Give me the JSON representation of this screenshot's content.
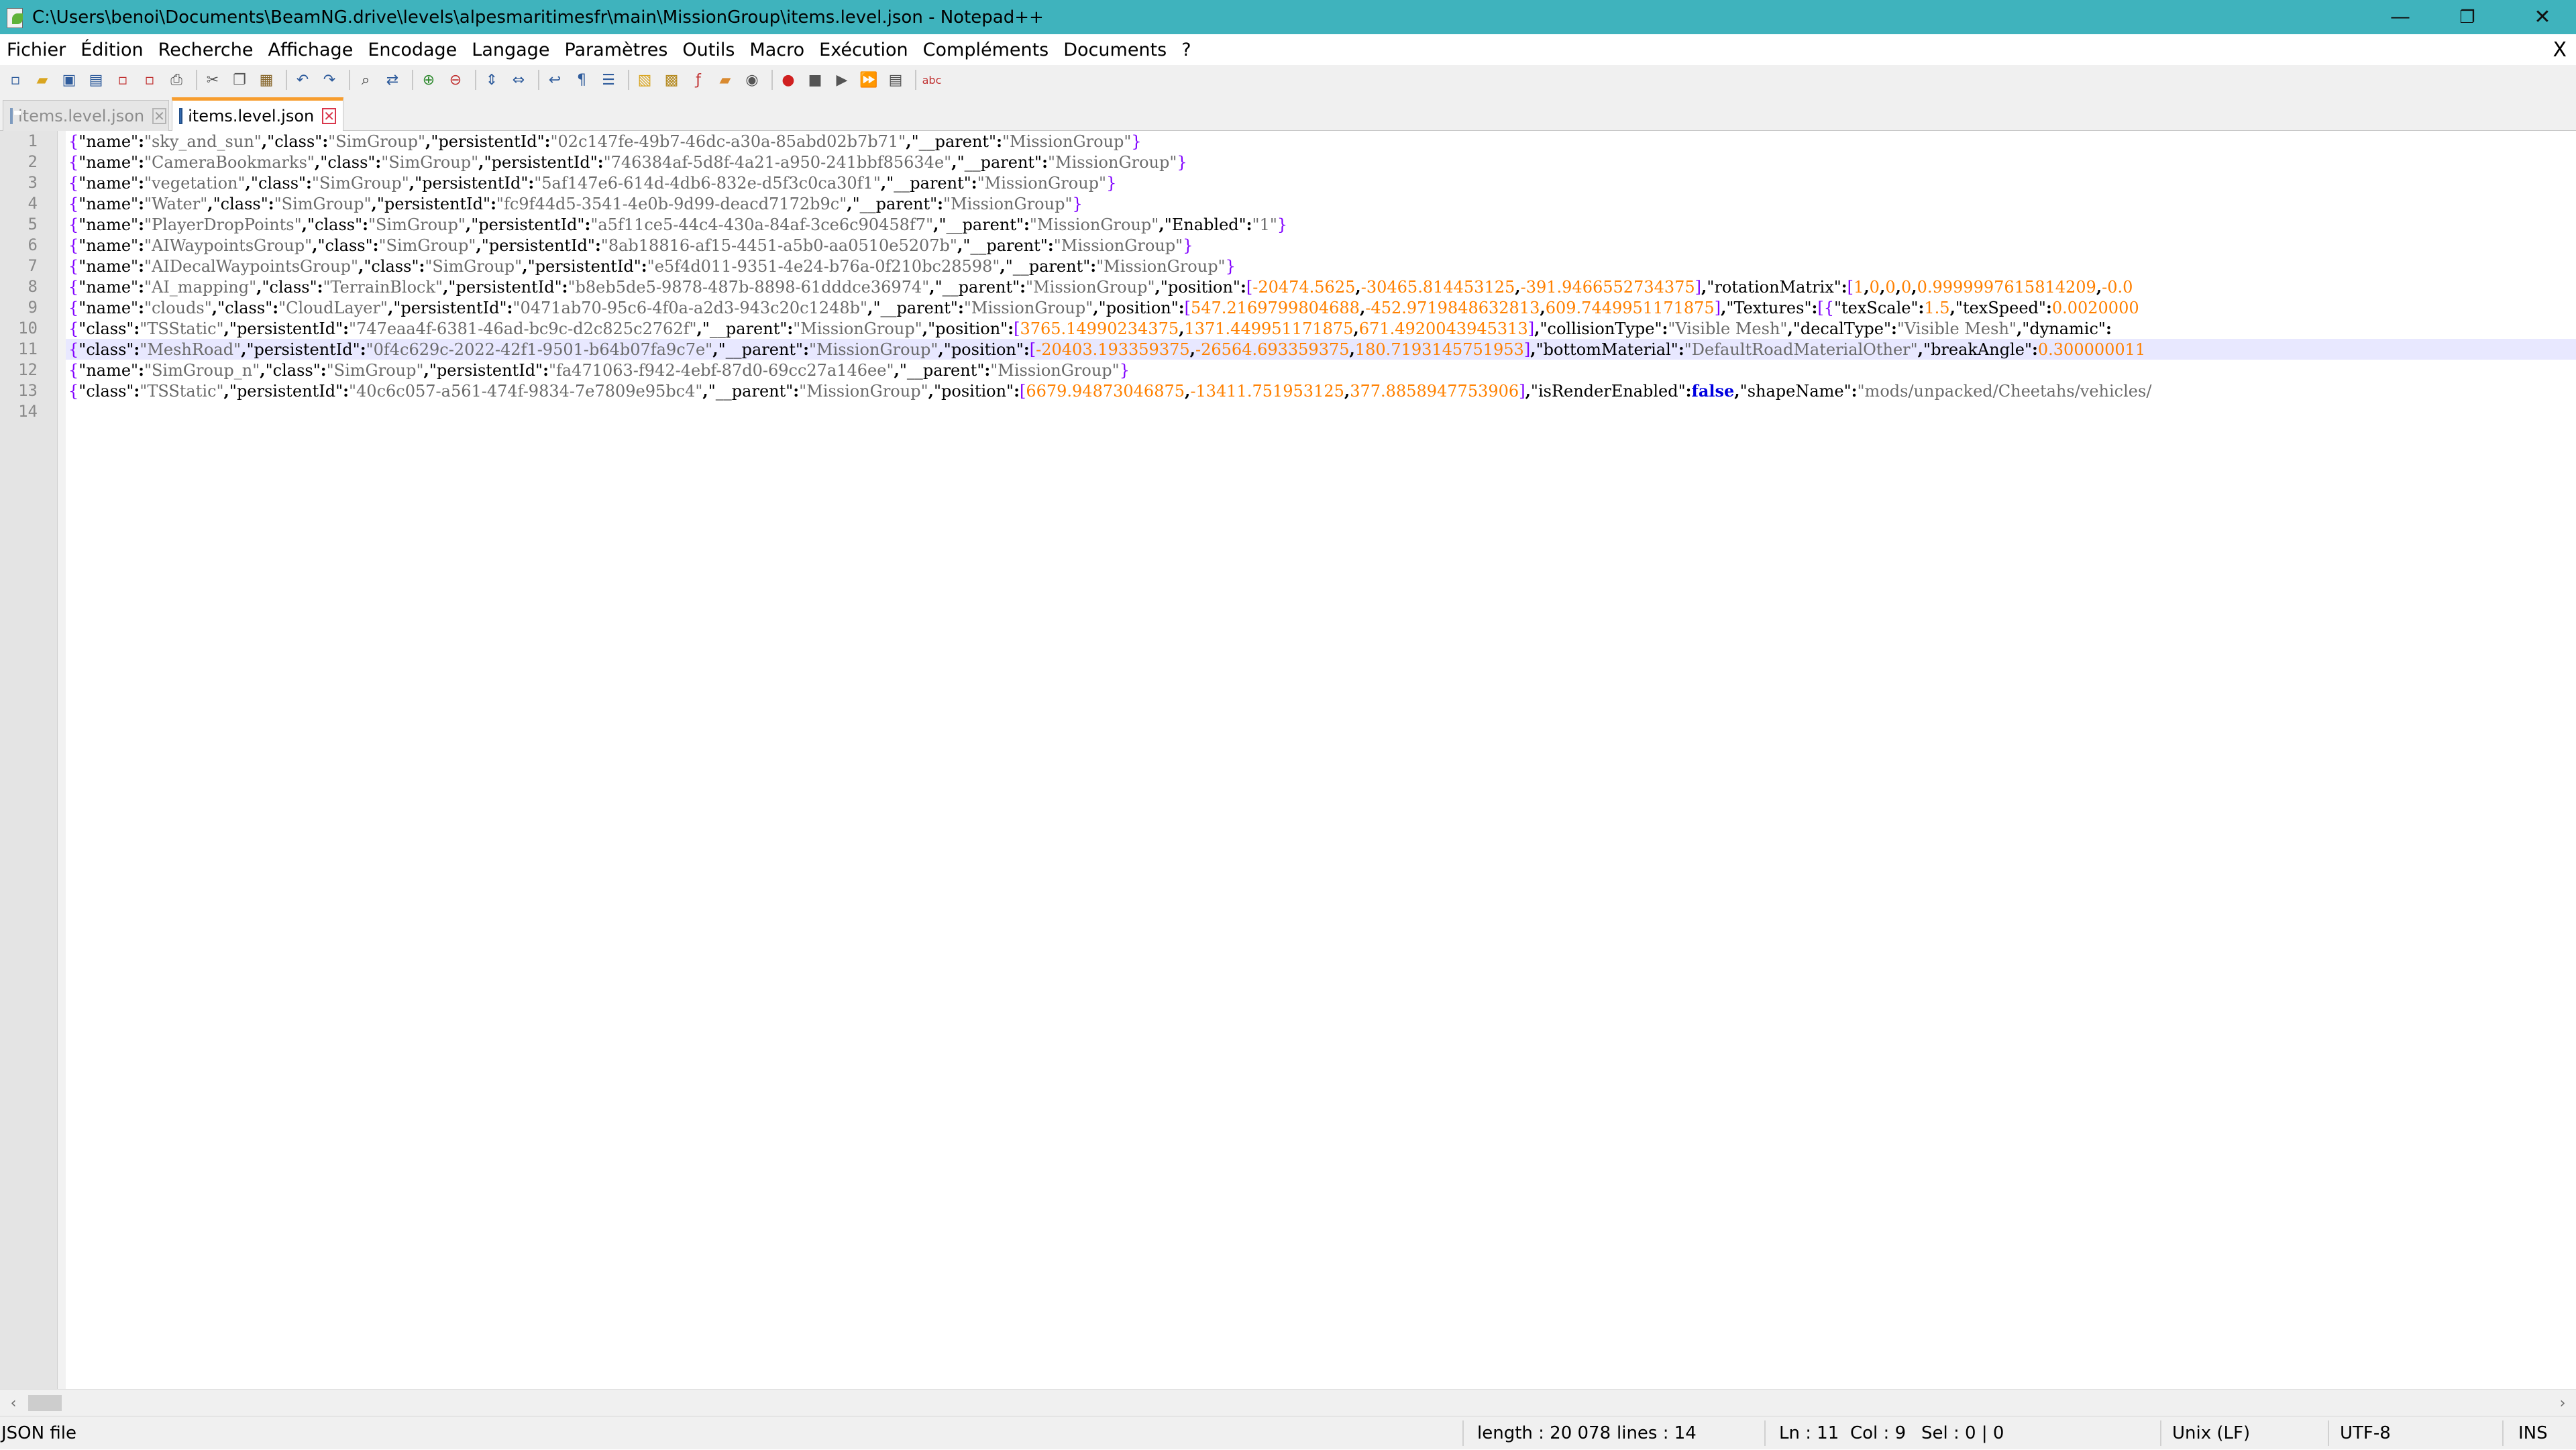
{
  "window": {
    "title": "C:\\Users\\benoi\\Documents\\BeamNG.drive\\levels\\alpesmaritimesfr\\main\\MissionGroup\\items.level.json - Notepad++",
    "controls": {
      "minimize": "—",
      "restore": "❐",
      "close": "✕"
    }
  },
  "menu": {
    "items": [
      "Fichier",
      "Édition",
      "Recherche",
      "Affichage",
      "Encodage",
      "Langage",
      "Paramètres",
      "Outils",
      "Macro",
      "Exécution",
      "Compléments",
      "Documents",
      "?"
    ],
    "close_label": "X"
  },
  "toolbar": {
    "icons": [
      "new-file-icon",
      "open-file-icon",
      "save-icon",
      "save-all-icon",
      "close-icon",
      "close-all-icon",
      "print-icon",
      "cut-icon",
      "copy-icon",
      "paste-icon",
      "undo-icon",
      "redo-icon",
      "find-icon",
      "replace-icon",
      "zoom-in-icon",
      "zoom-out-icon",
      "sync-vertical-icon",
      "sync-horizontal-icon",
      "word-wrap-icon",
      "show-all-chars-icon",
      "indent-guide-icon",
      "user-language-icon",
      "doc-map-icon",
      "function-list-icon",
      "folder-workspace-icon",
      "monitor-icon",
      "record-macro-icon",
      "stop-record-icon",
      "play-macro-icon",
      "run-multiple-macro-icon",
      "save-macro-icon",
      "spell-check-icon"
    ]
  },
  "tabs": [
    {
      "label": "items.level.json",
      "active": false
    },
    {
      "label": "items.level.json",
      "active": true
    }
  ],
  "editor": {
    "current_line": 11,
    "lines": [
      {
        "n": "1",
        "text": "{\"name\":\"sky_and_sun\",\"class\":\"SimGroup\",\"persistentId\":\"02c147fe-49b7-46dc-a30a-85abd02b7b71\",\"__parent\":\"MissionGroup\"}"
      },
      {
        "n": "2",
        "text": "{\"name\":\"CameraBookmarks\",\"class\":\"SimGroup\",\"persistentId\":\"746384af-5d8f-4a21-a950-241bbf85634e\",\"__parent\":\"MissionGroup\"}"
      },
      {
        "n": "3",
        "text": "{\"name\":\"vegetation\",\"class\":\"SimGroup\",\"persistentId\":\"5af147e6-614d-4db6-832e-d5f3c0ca30f1\",\"__parent\":\"MissionGroup\"}"
      },
      {
        "n": "4",
        "text": "{\"name\":\"Water\",\"class\":\"SimGroup\",\"persistentId\":\"fc9f44d5-3541-4e0b-9d99-deacd7172b9c\",\"__parent\":\"MissionGroup\"}"
      },
      {
        "n": "5",
        "text": "{\"name\":\"PlayerDropPoints\",\"class\":\"SimGroup\",\"persistentId\":\"a5f11ce5-44c4-430a-84af-3ce6c90458f7\",\"__parent\":\"MissionGroup\",\"Enabled\":\"1\"}"
      },
      {
        "n": "6",
        "text": "{\"name\":\"AIWaypointsGroup\",\"class\":\"SimGroup\",\"persistentId\":\"8ab18816-af15-4451-a5b0-aa0510e5207b\",\"__parent\":\"MissionGroup\"}"
      },
      {
        "n": "7",
        "text": "{\"name\":\"AIDecalWaypointsGroup\",\"class\":\"SimGroup\",\"persistentId\":\"e5f4d011-9351-4e24-b76a-0f210bc28598\",\"__parent\":\"MissionGroup\"}"
      },
      {
        "n": "8",
        "text": "{\"name\":\"AI_mapping\",\"class\":\"TerrainBlock\",\"persistentId\":\"b8eb5de5-9878-487b-8898-61dddce36974\",\"__parent\":\"MissionGroup\",\"position\":[-20474.5625,-30465.814453125,-391.9466552734375],\"rotationMatrix\":[1,0,0,0,0.9999997615814209,-0.0"
      },
      {
        "n": "9",
        "text": "{\"name\":\"clouds\",\"class\":\"CloudLayer\",\"persistentId\":\"0471ab70-95c6-4f0a-a2d3-943c20c1248b\",\"__parent\":\"MissionGroup\",\"position\":[547.2169799804688,-452.9719848632813,609.7449951171875],\"Textures\":[{\"texScale\":1.5,\"texSpeed\":0.0020000"
      },
      {
        "n": "10",
        "text": "{\"class\":\"TSStatic\",\"persistentId\":\"747eaa4f-6381-46ad-bc9c-d2c825c2762f\",\"__parent\":\"MissionGroup\",\"position\":[3765.14990234375,1371.449951171875,671.4920043945313],\"collisionType\":\"Visible Mesh\",\"decalType\":\"Visible Mesh\",\"dynamic\":"
      },
      {
        "n": "11",
        "text": "{\"class\":\"MeshRoad\",\"persistentId\":\"0f4c629c-2022-42f1-9501-b64b07fa9c7e\",\"__parent\":\"MissionGroup\",\"position\":[-20403.193359375,-26564.693359375,180.7193145751953],\"bottomMaterial\":\"DefaultRoadMaterialOther\",\"breakAngle\":0.300000011"
      },
      {
        "n": "12",
        "text": "{\"name\":\"SimGroup_n\",\"class\":\"SimGroup\",\"persistentId\":\"fa471063-f942-4ebf-87d0-69cc27a146ee\",\"__parent\":\"MissionGroup\"}"
      },
      {
        "n": "13",
        "text": "{\"class\":\"TSStatic\",\"persistentId\":\"40c6c057-a561-474f-9834-7e7809e95bc4\",\"__parent\":\"MissionGroup\",\"position\":[6679.94873046875,-13411.751953125,377.8858947753906],\"isRenderEnabled\":false,\"shapeName\":\"mods/unpacked/Cheetahs/vehicles/"
      },
      {
        "n": "14",
        "text": ""
      }
    ]
  },
  "statusbar": {
    "file_type": "JSON file",
    "length": "length : 20 078",
    "lines": "lines : 14",
    "ln": "Ln : 11",
    "col": "Col : 9",
    "sel": "Sel : 0 | 0",
    "eol": "Unix (LF)",
    "encoding": "UTF-8",
    "mode": "INS"
  },
  "colors": {
    "titlebar": "#3fb3bd",
    "active_tab_accent": "#f79d2e",
    "brace": "#8000ff",
    "number": "#ff8000",
    "boolean": "#0000e0",
    "current_line": "#e8e8ff"
  }
}
